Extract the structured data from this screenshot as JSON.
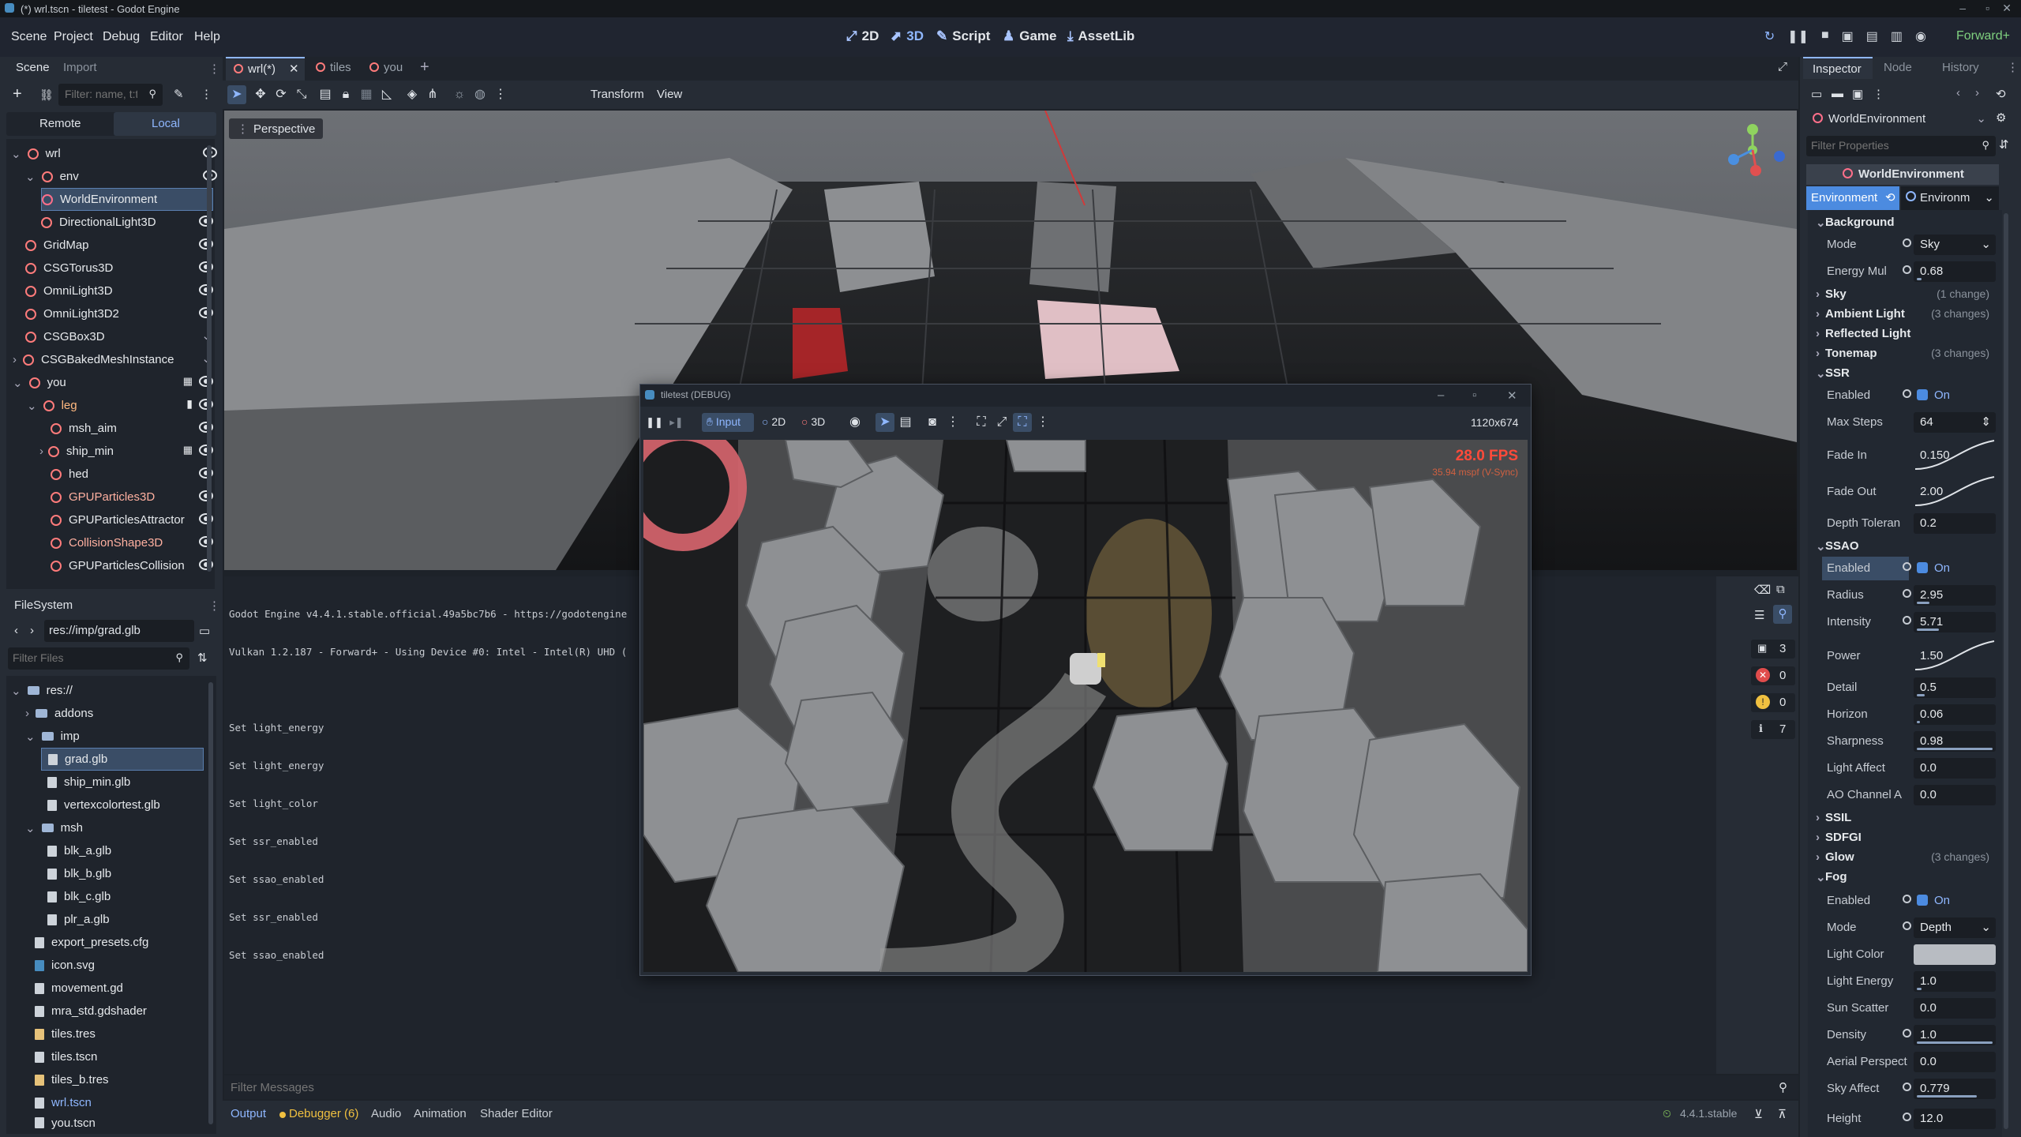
{
  "window_title": "(*) wrl.tscn - tiletest - Godot Engine",
  "menu": [
    "Scene",
    "Project",
    "Debug",
    "Editor",
    "Help"
  ],
  "workspaces": [
    "2D",
    "3D",
    "Script",
    "Game",
    "AssetLib"
  ],
  "renderer": "Forward+",
  "scene_dock": {
    "tabs": [
      "Scene",
      "Import"
    ],
    "filter_placeholder": "Filter: name, t:t",
    "remote": "Remote",
    "local": "Local",
    "tree": [
      "wrl",
      "env",
      "WorldEnvironment",
      "DirectionalLight3D",
      "GridMap",
      "CSGTorus3D",
      "OmniLight3D",
      "OmniLight3D2",
      "CSGBox3D",
      "CSGBakedMeshInstance",
      "you",
      "leg",
      "msh_aim",
      "ship_min",
      "hed",
      "GPUParticles3D",
      "GPUParticlesAttractor",
      "CollisionShape3D",
      "GPUParticlesCollision"
    ]
  },
  "filesystem": {
    "title": "FileSystem",
    "path": "res://imp/grad.glb",
    "filter_placeholder": "Filter Files",
    "items": [
      "res://",
      "addons",
      "imp",
      "grad.glb",
      "ship_min.glb",
      "vertexcolortest.glb",
      "msh",
      "blk_a.glb",
      "blk_b.glb",
      "blk_c.glb",
      "plr_a.glb",
      "export_presets.cfg",
      "icon.svg",
      "movement.gd",
      "mra_std.gdshader",
      "tiles.tres",
      "tiles.tscn",
      "tiles_b.tres",
      "wrl.tscn",
      "you.tscn"
    ]
  },
  "scene_tabs": [
    "wrl(*)",
    "tiles",
    "you"
  ],
  "viewport": {
    "transform": "Transform",
    "view": "View",
    "perspective": "Perspective"
  },
  "game_window": {
    "title": "tiletest (DEBUG)",
    "input": "Input",
    "d2": "2D",
    "d3": "3D",
    "resolution": "1120x674",
    "fps": "28.0 FPS",
    "fps_sub": "35.94 mspf (V-Sync)"
  },
  "output": {
    "lines": [
      "Godot Engine v4.4.1.stable.official.49a5bc7b6 - https://godotengine",
      "Vulkan 1.2.187 - Forward+ - Using Device #0: Intel - Intel(R) UHD (",
      "",
      "Set light_energy",
      "Set light_energy",
      "Set light_color",
      "Set ssr_enabled",
      "Set ssao_enabled",
      "Set ssr_enabled",
      "Set ssao_enabled"
    ],
    "filter_placeholder": "Filter Messages",
    "counts": [
      "3",
      "0",
      "0",
      "7"
    ]
  },
  "bottom_tabs": [
    "Output",
    "Debugger (6)",
    "Audio",
    "Animation",
    "Shader Editor"
  ],
  "version": "4.4.1.stable",
  "inspector": {
    "tabs": [
      "Inspector",
      "Node",
      "History"
    ],
    "object": "WorldEnvironment",
    "filter_placeholder": "Filter Properties",
    "header": "WorldEnvironment",
    "env_prop": "Environment",
    "env_res": "Environm",
    "sections": {
      "background": "Background",
      "sky": "Sky",
      "sky_chg": "(1 change)",
      "ambient": "Ambient Light",
      "ambient_chg": "(3 changes)",
      "reflected": "Reflected Light",
      "tonemap": "Tonemap",
      "tonemap_chg": "(3 changes)",
      "ssr": "SSR",
      "ssao": "SSAO",
      "ssil": "SSIL",
      "sdfgi": "SDFGI",
      "glow": "Glow",
      "glow_chg": "(3 changes)",
      "fog": "Fog"
    },
    "bg": {
      "mode": "Mode",
      "mode_val": "Sky",
      "energy": "Energy Mul",
      "energy_val": "0.68"
    },
    "ssr": {
      "enabled": "Enabled",
      "on": "On",
      "max_steps": "Max Steps",
      "max_steps_val": "64",
      "fade_in": "Fade In",
      "fade_in_val": "0.150",
      "fade_out": "Fade Out",
      "fade_out_val": "2.00",
      "depth": "Depth Toleran",
      "depth_val": "0.2"
    },
    "ssao": {
      "enabled": "Enabled",
      "on": "On",
      "radius": "Radius",
      "radius_val": "2.95",
      "intensity": "Intensity",
      "intensity_val": "5.71",
      "power": "Power",
      "power_val": "1.50",
      "detail": "Detail",
      "detail_val": "0.5",
      "horizon": "Horizon",
      "horizon_val": "0.06",
      "sharpness": "Sharpness",
      "sharpness_val": "0.98",
      "light_affect": "Light Affect",
      "light_affect_val": "0.0",
      "ao_channel": "AO Channel A",
      "ao_channel_val": "0.0"
    },
    "fog": {
      "enabled": "Enabled",
      "on": "On",
      "mode": "Mode",
      "mode_val": "Depth",
      "light_color": "Light Color",
      "light_energy": "Light Energy",
      "light_energy_val": "1.0",
      "sun_scatter": "Sun Scatter",
      "sun_scatter_val": "0.0",
      "density": "Density",
      "density_val": "1.0",
      "aerial": "Aerial Perspect",
      "aerial_val": "0.0",
      "sky_affect": "Sky Affect",
      "sky_affect_val": "0.779",
      "height": "Height",
      "height_val": "12.0"
    }
  }
}
